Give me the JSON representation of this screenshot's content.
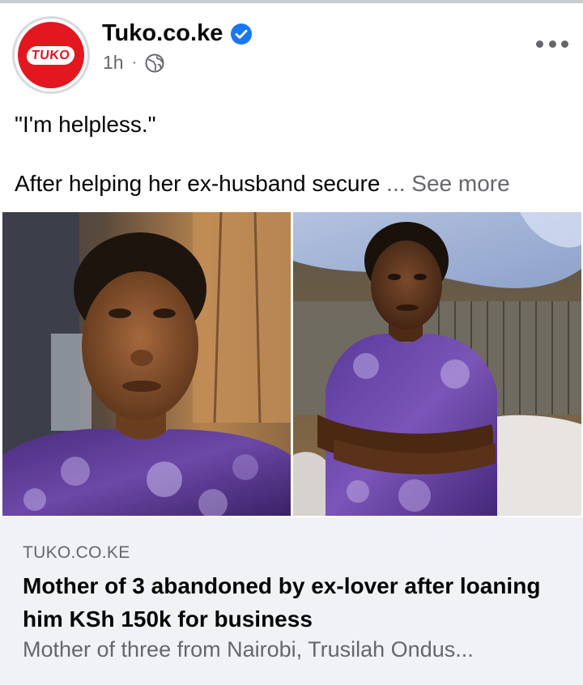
{
  "post": {
    "page_name": "Tuko.co.ke",
    "logo_text": "TUKO",
    "timestamp": "1h",
    "separator": "·",
    "audience_icon": "globe-icon",
    "verified_icon": "verified-badge-icon",
    "quote": "\"I'm helpless.\"",
    "excerpt": "After helping her ex-husband secure",
    "see_more": "... See more"
  },
  "link_preview": {
    "domain": "TUKO.CO.KE",
    "headline": "Mother of 3 abandoned by ex-lover after loaning him KSh 150k for business",
    "description": "Mother of three from Nairobi, Trusilah Ondus..."
  },
  "colors": {
    "brand_red": "#e3171f",
    "verified_blue": "#1877f2",
    "secondary_text": "#65676b",
    "card_background": "#f0f2f5"
  }
}
